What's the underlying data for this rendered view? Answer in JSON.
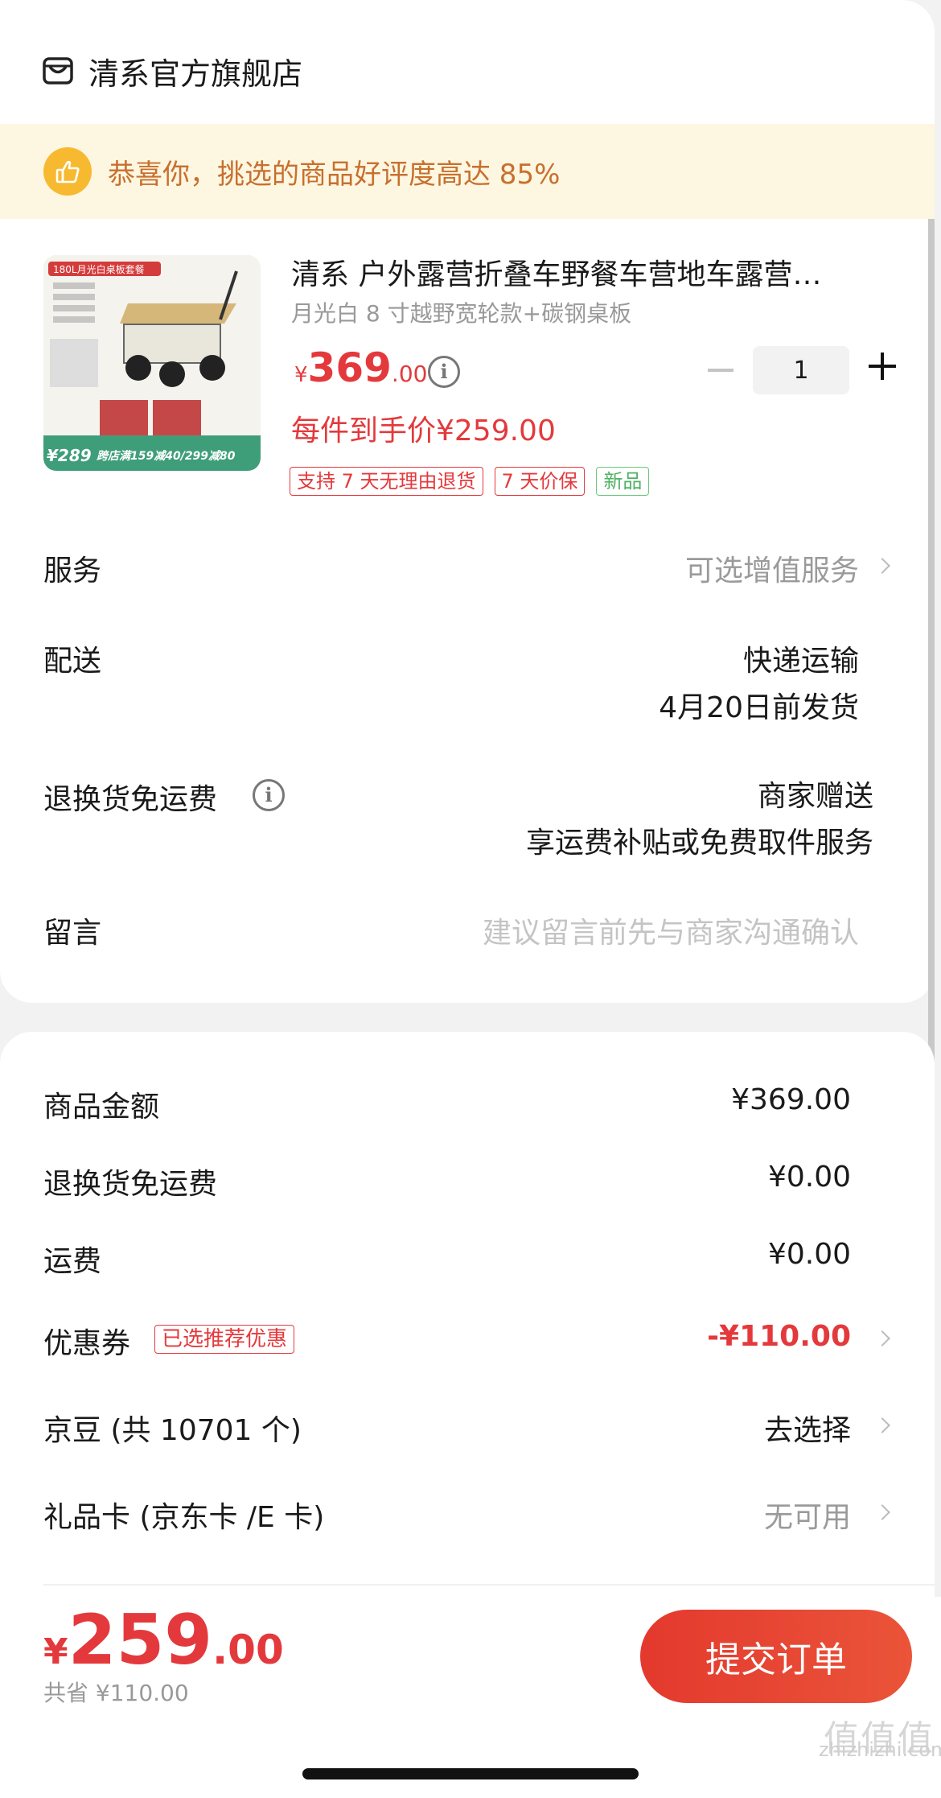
{
  "shop": {
    "name": "清系官方旗舰店"
  },
  "banner": {
    "text": "恭喜你，挑选的商品好评度高达 85%"
  },
  "product": {
    "image_caption_top": "180L月光白桌板套餐",
    "image_caption_bottom": "跨店满159减40/299减80",
    "image_price": "¥289",
    "title": "清系 户外露营折叠车野餐车营地车露营…",
    "spec": "月光白 8 寸越野宽轮款+碳钢桌板",
    "price_yen": "¥",
    "price_int": "369",
    "price_dec": ".00",
    "quantity": "1",
    "final_price": "每件到手价¥259.00",
    "tags": [
      "支持 7 天无理由退货",
      "7 天价保",
      "新品"
    ]
  },
  "service": {
    "label": "服务",
    "value": "可选增值服务"
  },
  "delivery": {
    "label": "配送",
    "line1": "快递运输",
    "line2": "4月20日前发货"
  },
  "return_shipping": {
    "label": "退换货免运费",
    "line1": "商家赠送",
    "line2": "享运费补贴或免费取件服务"
  },
  "message": {
    "label": "留言",
    "placeholder": "建议留言前先与商家沟通确认"
  },
  "summary": {
    "goods_label": "商品金额",
    "goods_value": "¥369.00",
    "return_label": "退换货免运费",
    "return_value": "¥0.00",
    "freight_label": "运费",
    "freight_value": "¥0.00",
    "coupon_label": "优惠券",
    "coupon_badge": "已选推荐优惠",
    "coupon_value": "-¥110.00",
    "beans_label": "京豆 (共 10701 个)",
    "beans_value": "去选择",
    "giftcard_label": "礼品卡 (京东卡 /E 卡)",
    "giftcard_value": "无可用"
  },
  "footer": {
    "total_yen": "¥",
    "total_int": "259",
    "total_dec": ".00",
    "saved": "共省 ¥110.00",
    "submit": "提交订单"
  },
  "watermark": {
    "logo": "值值值",
    "url": "zhizhizhi.com"
  },
  "colors": {
    "accent": "#e4393c",
    "banner_bg": "#fdf6e1",
    "banner_text": "#c7702e"
  }
}
